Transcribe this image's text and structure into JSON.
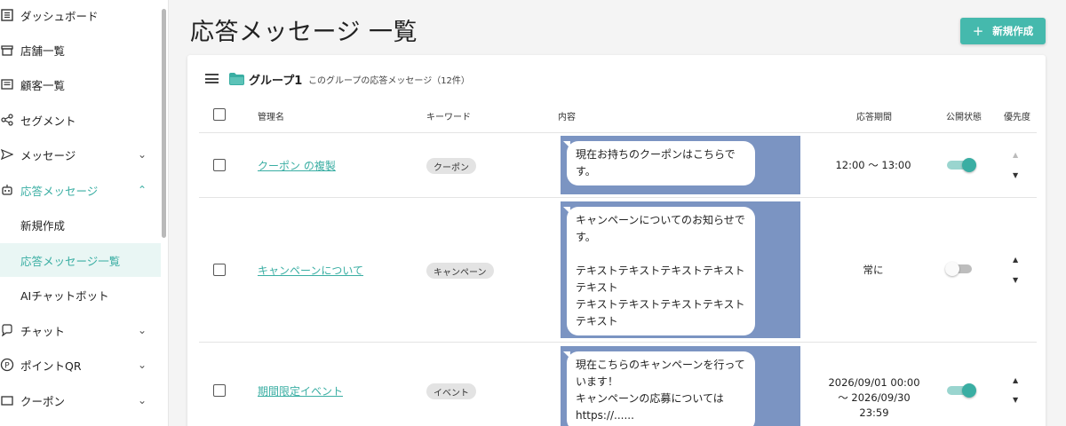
{
  "sidebar": {
    "items": [
      {
        "label": "ダッシュボード",
        "icon": "dashboard-icon"
      },
      {
        "label": "店舗一覧",
        "icon": "store-icon"
      },
      {
        "label": "顧客一覧",
        "icon": "customer-list-icon"
      },
      {
        "label": "セグメント",
        "icon": "segment-icon"
      },
      {
        "label": "メッセージ",
        "icon": "send-icon"
      },
      {
        "label": "応答メッセージ",
        "icon": "bot-icon"
      },
      {
        "label": "新規作成"
      },
      {
        "label": "応答メッセージ一覧"
      },
      {
        "label": "AIチャットボット"
      },
      {
        "label": "チャット",
        "icon": "chat-icon"
      },
      {
        "label": "ポイントQR",
        "icon": "point-icon"
      },
      {
        "label": "クーポン",
        "icon": "coupon-icon"
      }
    ]
  },
  "page": {
    "title": "応答メッセージ 一覧",
    "create_button": "新規作成"
  },
  "group": {
    "name": "グループ1",
    "description": "このグループの応答メッセージ（12件）"
  },
  "table": {
    "headers": {
      "name": "管理名",
      "keyword": "キーワード",
      "content": "内容",
      "period": "応答期間",
      "status": "公開状態",
      "priority": "優先度"
    },
    "rows": [
      {
        "name": "クーポン の複製",
        "keyword": "クーポン",
        "content": "現在お持ちのクーポンはこちらです。",
        "period": "12:00 ～ 13:00",
        "published": true
      },
      {
        "name": "キャンペーンについて",
        "keyword": "キャンペーン",
        "content": "キャンペーンについてのお知らせです。\n\nテキストテキストテキストテキストテキスト\nテキストテキストテキストテキストテキスト",
        "period": "常に",
        "published": false
      },
      {
        "name": "期間限定イベント",
        "keyword": "イベント",
        "content": "現在こちらのキャンペーンを行っています！\nキャンペーンの応募については\nhttps://......",
        "period": "2026/09/01 00:00\n～ 2026/09/30 23:59",
        "published": true
      }
    ]
  },
  "colors": {
    "accent": "#3aaea3",
    "button": "#45b9ad",
    "preview_bg": "#7b94c2"
  }
}
